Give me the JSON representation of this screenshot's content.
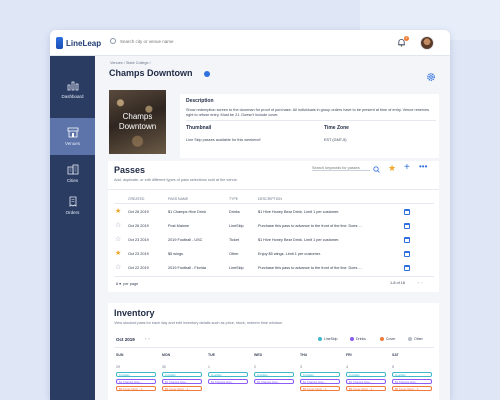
{
  "app": {
    "name": "LineLeap"
  },
  "topbar": {
    "search_placeholder": "Search city or venue name",
    "notification_count": "2"
  },
  "sidebar": [
    {
      "label": "Dashboard",
      "icon": "bar-chart-icon",
      "active": false
    },
    {
      "label": "Venues",
      "icon": "storefront-icon",
      "active": true
    },
    {
      "label": "Cities",
      "icon": "buildings-icon",
      "active": false
    },
    {
      "label": "Orders",
      "icon": "receipt-icon",
      "active": false
    }
  ],
  "breadcrumb": "Venues  /  State College  /",
  "venue": {
    "title": "Champs Downtown",
    "thumb_line1": "Champs",
    "thumb_line2": "Downtown",
    "description_label": "Description",
    "description_text": "Show redemption screen to the doorman for proof of purchase. All individuals in group orders have to be present at time of entry. Venue reserves right to refuse entry. Must be 21. Doesn't include cover.",
    "thumbnail_label": "Thumbnail",
    "thumbnail_text": "Line Skip passes available for this weekend!",
    "timezone_label": "Time Zone",
    "timezone_text": "EST (GMT-5)"
  },
  "passes": {
    "title": "Passes",
    "subtitle": "Add, duplicate, or edit different types of pass selections sold at the venue.",
    "search_placeholder": "Search keywords for passes",
    "columns": [
      "CREATED",
      "PASS NAME",
      "TYPE",
      "DESCRIPTION"
    ],
    "rows": [
      {
        "starred": true,
        "created": "Oct 26 2019",
        "name": "$1 Champs Hive Drink",
        "type": "Drinks",
        "desc": "$1 Hive Honey Bear Drink. Limit 1 per customer."
      },
      {
        "starred": false,
        "created": "Oct 26 2019",
        "name": "Post Malone",
        "type": "LineSkip",
        "desc": "Purchase this pass to advance to the front of the line. Does ..."
      },
      {
        "starred": false,
        "created": "Oct 23 2019",
        "name": "2019 Football - USC",
        "type": "Ticket",
        "desc": "$1 Hive Honey Bear Drink. Limit 1 per customer."
      },
      {
        "starred": true,
        "created": "Oct 23 2019",
        "name": "$5 wings",
        "type": "Other",
        "desc": "Enjoy $5 wings. Limit 1 per customer."
      },
      {
        "starred": false,
        "created": "Oct 22 2019",
        "name": "2019 Football - Florida",
        "type": "LineSkip",
        "desc": "Purchase this pass to advance to the front of the line. Does ..."
      }
    ],
    "per_page_value": "8",
    "per_page_label": "per page",
    "pagination": "1-8 of 18"
  },
  "inventory": {
    "title": "Inventory",
    "subtitle": "View stocked pass for each day and edit inventory details such as price, stock, redeem time window.",
    "month": "Oct 2019",
    "legend": [
      {
        "label": "LineSkip",
        "color": "#3fb8c9"
      },
      {
        "label": "Drinks",
        "color": "#8b5cf6"
      },
      {
        "label": "Cover",
        "color": "#f07a3a"
      },
      {
        "label": "Other",
        "color": "#b7bdc9"
      }
    ],
    "days": [
      "SUN",
      "MON",
      "TUE",
      "WED",
      "THU",
      "FRI",
      "SAT"
    ],
    "dates": [
      "29",
      "30",
      "1",
      "2",
      "3",
      "4",
      "5"
    ],
    "pill_lineskip": "LineSkip",
    "pill_drink": "$1 Champs Hive...",
    "pill_cover": "$5 Cover 10pm - 1..."
  },
  "colors": {
    "accent": "#2f6fe0",
    "sidebar": "#2b3c63",
    "sidebar_active": "#5d74ab",
    "star": "#f0a72a"
  }
}
